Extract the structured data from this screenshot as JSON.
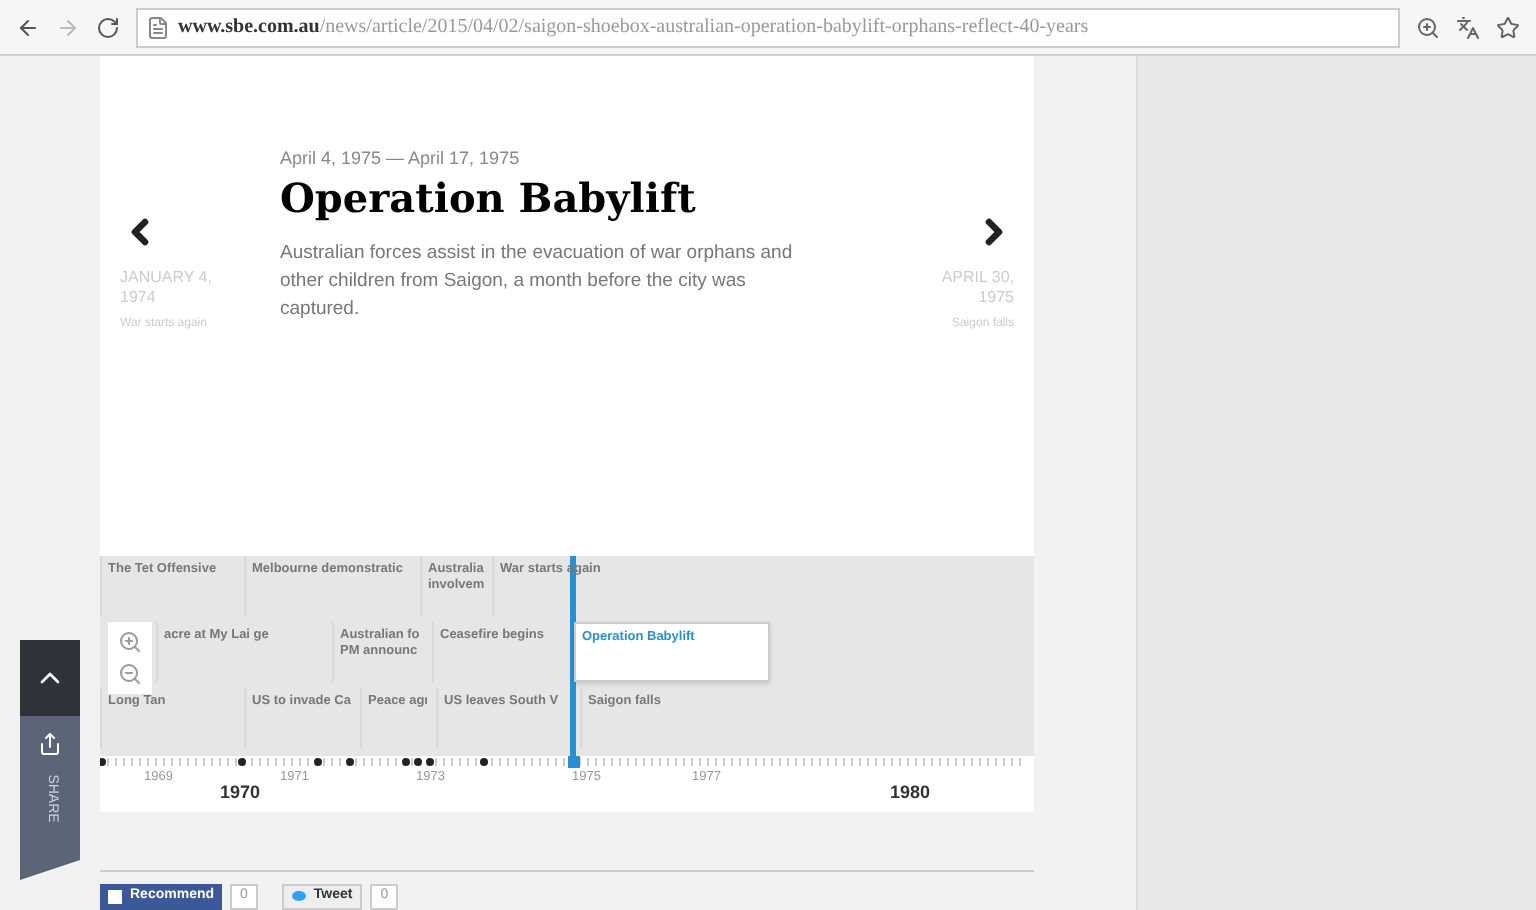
{
  "browser": {
    "url_domain": "www.sbe.com.au",
    "url_path": "/news/article/2015/04/02/saigon-shoebox-australian-operation-babylift-orphans-reflect-40-years"
  },
  "slide": {
    "dates": "April 4, 1975 — April 17, 1975",
    "title": "Operation Babylift",
    "body": "Australian forces assist in the evacuation of war orphans and other children from Saigon, a month before the city was captured."
  },
  "prev": {
    "date": "JANUARY 4, 1974",
    "caption": "War starts again"
  },
  "next": {
    "date": "APRIL 30, 1975",
    "caption": "Saigon falls"
  },
  "events": [
    {
      "label": "The Tet Offensive",
      "selected": false
    },
    {
      "label": "Melbourne demonstratic",
      "selected": false
    },
    {
      "label": "Australia involvem",
      "selected": false
    },
    {
      "label": "War starts again",
      "selected": false
    },
    {
      "label": "acre at My Lai ge",
      "selected": false
    },
    {
      "label": "Australian fo PM announc",
      "selected": false
    },
    {
      "label": "Ceasefire begins",
      "selected": false
    },
    {
      "label": "Operation Babylift",
      "selected": true
    },
    {
      "label": "Long Tan",
      "selected": false
    },
    {
      "label": "US to invade Ca",
      "selected": false
    },
    {
      "label": "Peace agı",
      "selected": false
    },
    {
      "label": "US leaves South V",
      "selected": false
    },
    {
      "label": "Saigon falls",
      "selected": false
    }
  ],
  "years": [
    {
      "label": "1969",
      "major": false
    },
    {
      "label": "1970",
      "major": true
    },
    {
      "label": "1971",
      "major": false
    },
    {
      "label": "1973",
      "major": false
    },
    {
      "label": "1975",
      "major": false
    },
    {
      "label": "1977",
      "major": false
    },
    {
      "label": "1980",
      "major": true
    }
  ],
  "share": {
    "label": "SHARE"
  },
  "social": {
    "recommend": "Recommend",
    "recommend_count": "0",
    "tweet": "Tweet",
    "tweet_count": "0"
  }
}
